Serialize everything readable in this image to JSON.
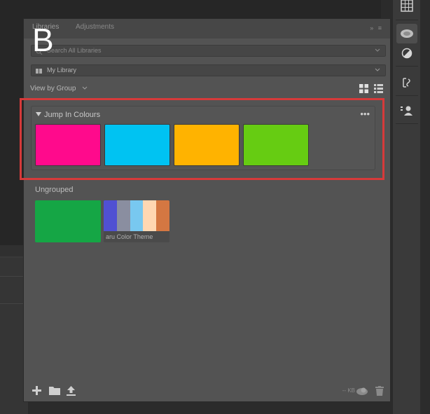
{
  "overlay_letter": "B",
  "panel": {
    "tabs": [
      {
        "label": "Libraries"
      },
      {
        "label": "Adjustments"
      }
    ],
    "search_placeholder": "Search All Libraries",
    "library_select": "My Library",
    "view_by_label": "View by Group",
    "group": {
      "title": "Jump In Colours",
      "more_label": "•••",
      "swatches": [
        "#ff0a8c",
        "#00c3f2",
        "#ffb300",
        "#66cc12"
      ]
    },
    "ungrouped": {
      "title": "Ungrouped",
      "swatch_color": "#15a645",
      "theme": {
        "label": "aru Color Theme",
        "colors": [
          "#5050d2",
          "#8a8ea0",
          "#78c8f0",
          "#ffd7b2",
          "#d47742"
        ]
      }
    },
    "footer_size": "-- KB"
  },
  "colors": {
    "panel_bg": "#535353",
    "highlight": "#d63a3a"
  }
}
